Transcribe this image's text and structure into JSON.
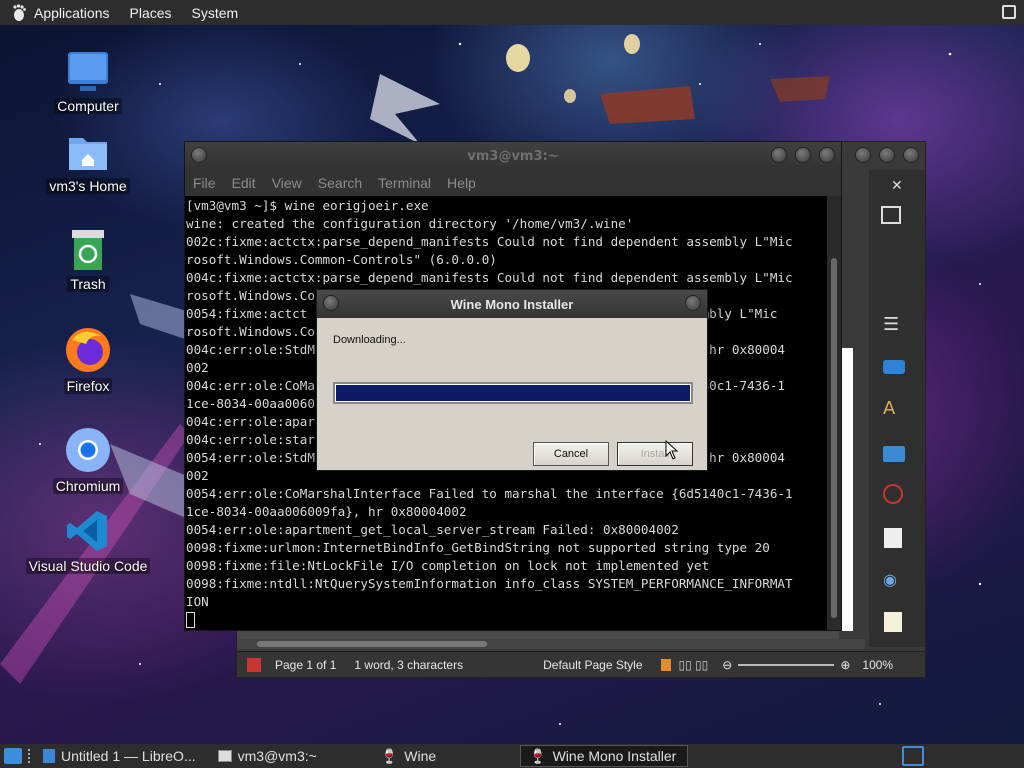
{
  "top_panel": {
    "applications": "Applications",
    "places": "Places",
    "system": "System"
  },
  "desktop_icons": [
    {
      "label": "Computer",
      "icon": "computer-icon"
    },
    {
      "label": "vm3's Home",
      "icon": "home-folder-icon"
    },
    {
      "label": "Trash",
      "icon": "trash-icon"
    },
    {
      "label": "Firefox",
      "icon": "firefox-icon"
    },
    {
      "label": "Chromium",
      "icon": "chromium-icon"
    },
    {
      "label": "Visual Studio Code",
      "icon": "vscode-icon"
    }
  ],
  "terminal": {
    "title": "vm3@vm3:~",
    "menu": [
      "File",
      "Edit",
      "View",
      "Search",
      "Terminal",
      "Help"
    ],
    "lines": [
      "[vm3@vm3 ~]$ wine eorigjoeir.exe",
      "wine: created the configuration directory '/home/vm3/.wine'",
      "002c:fixme:actctx:parse_depend_manifests Could not find dependent assembly L\"Mic",
      "rosoft.Windows.Common-Controls\" (6.0.0.0)",
      "004c:fixme:actctx:parse_depend_manifests Could not find dependent assembly L\"Mic",
      "rosoft.Windows.Co",
      "0054:fixme:actct                                                assembly L\"Mic",
      "rosoft.Windows.Co",
      "004c:err:ole:StdM                                               tub, hr 0x80004",
      "002",
      "004c:err:ole:CoMa                                               6d5140c1-7436-1",
      "1ce-8034-00aa0060",
      "004c:err:ole:apar",
      "004c:err:ole:star",
      "0054:err:ole:StdM                                               tub, hr 0x80004",
      "002",
      "0054:err:ole:CoMarshalInterface Failed to marshal the interface {6d5140c1-7436-1",
      "1ce-8034-00aa006009fa}, hr 0x80004002",
      "0054:err:ole:apartment_get_local_server_stream Failed: 0x80004002",
      "0098:fixme:urlmon:InternetBindInfo_GetBindString not supported string type 20",
      "0098:fixme:file:NtLockFile I/O completion on lock not implemented yet",
      "0098:fixme:ntdll:NtQuerySystemInformation info_class SYSTEM_PERFORMANCE_INFORMAT",
      "ION"
    ]
  },
  "dialog": {
    "title": "Wine Mono Installer",
    "message": "Downloading...",
    "progress": 1.0,
    "cancel": "Cancel",
    "install": "Install"
  },
  "writer": {
    "status": {
      "page": "Page 1 of 1",
      "words": "1 word, 3 characters",
      "style": "Default Page Style",
      "zoom": "100%"
    }
  },
  "taskbar": {
    "items": [
      {
        "label": "Untitled 1 — LibreO...",
        "icon": "libreoffice-writer-icon"
      },
      {
        "label": "vm3@vm3:~",
        "icon": "terminal-icon"
      },
      {
        "label": "Wine",
        "icon": "wine-icon"
      },
      {
        "label": "Wine Mono Installer",
        "icon": "wine-icon"
      }
    ]
  },
  "colors": {
    "progress_fill": "#0b1c63",
    "panel": "#2d2d2d"
  }
}
